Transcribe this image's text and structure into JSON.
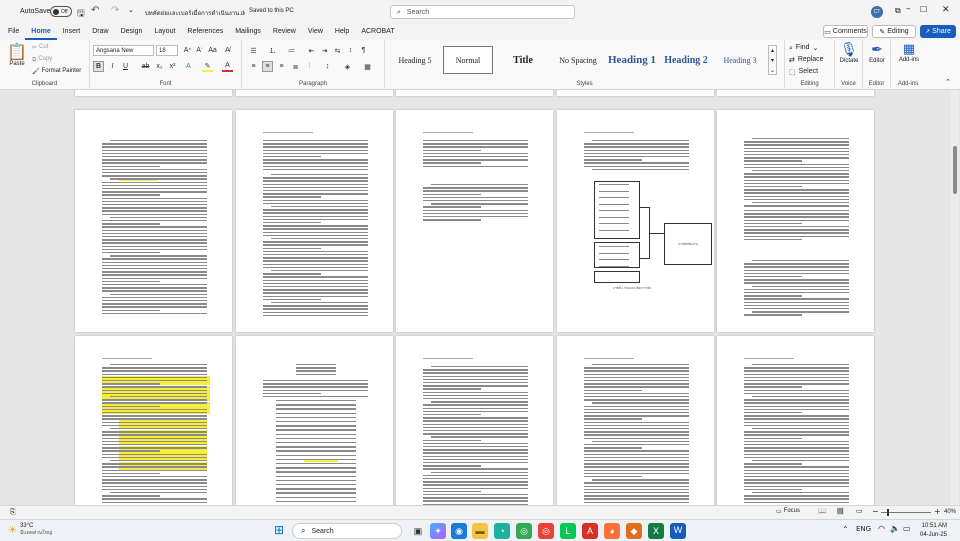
{
  "titlebar": {
    "autosave_label": "AutoSave",
    "autosave_state": "Off",
    "doc_title": "บทคัดย่อเเละเบอร์เมื่อการดำเนินงาน.docx",
    "save_status": "Saved to this PC",
    "search_placeholder": "Search",
    "user_initials": "CT"
  },
  "tabs": [
    "File",
    "Home",
    "Insert",
    "Draw",
    "Design",
    "Layout",
    "References",
    "Mailings",
    "Review",
    "View",
    "Help",
    "ACROBAT"
  ],
  "right_buttons": {
    "comments": "Comments",
    "editing": "Editing",
    "share": "Share"
  },
  "clipboard": {
    "paste": "Paste",
    "cut": "Cut",
    "copy": "Copy",
    "format_painter": "Format Painter",
    "label": "Clipboard"
  },
  "font": {
    "name": "Angsana New",
    "size": "18",
    "label": "Font"
  },
  "paragraph": {
    "label": "Paragraph"
  },
  "styles": {
    "items": [
      "Heading 5",
      "Normal",
      "Title",
      "No Spacing",
      "Heading 1",
      "Heading 2",
      "Heading 3"
    ],
    "label": "Styles"
  },
  "editing": {
    "find": "Find",
    "replace": "Replace",
    "select": "Select",
    "label": "Editing"
  },
  "voice": {
    "dictate": "Dictate",
    "label": "Voice"
  },
  "editor": {
    "editor": "Editor",
    "label": "Editor"
  },
  "addins": {
    "addins": "Add-ins",
    "label": "Add-ins"
  },
  "figure": {
    "box_label": "การดำเนินงาน",
    "caption": "ภาพที่ 1 กรอบแนวคิดการวิจัย"
  },
  "status": {
    "focus": "Focus",
    "zoom": "40%"
  },
  "taskbar": {
    "temp": "33°C",
    "weather": "มีแดดส่วนใหญ่",
    "search": "Search",
    "time": "10:51 AM",
    "date": "04-Jun-25"
  },
  "colors": {
    "accent": "#185abd",
    "highlight": "#f7ee3a",
    "word_blue": "#2b579a"
  }
}
